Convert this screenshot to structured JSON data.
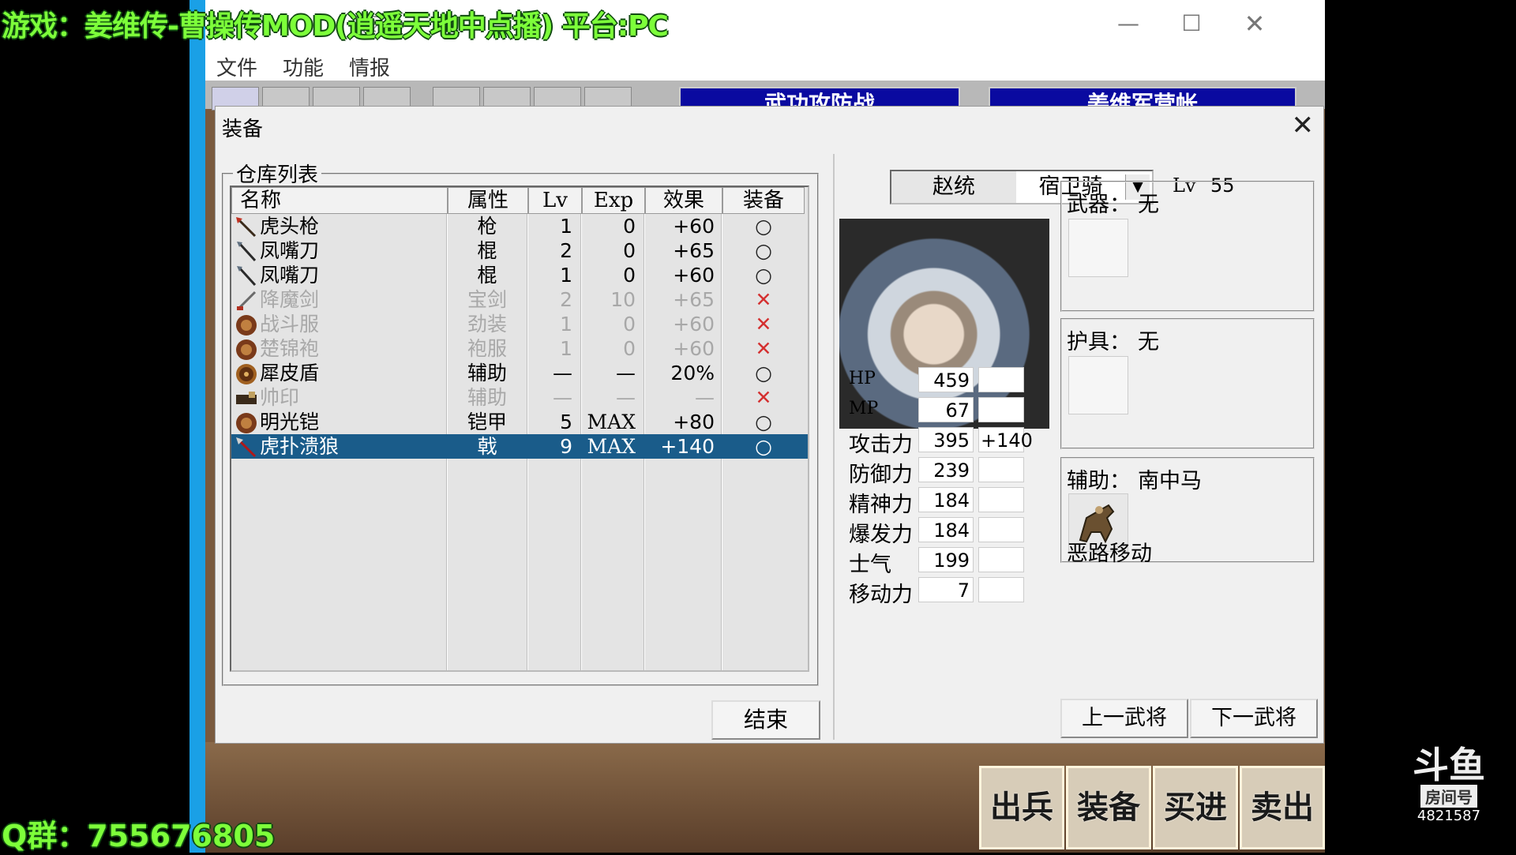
{
  "overlay": {
    "title": "游戏：姜维传-曹操传MOD(逍遥天地中点播)  平台:PC",
    "qq_group": "Q群：755676805",
    "logo_text": "斗鱼",
    "room_label": "房间号",
    "room_number": "4821587"
  },
  "window": {
    "title_fragment": "传",
    "minimize_icon": "—",
    "maximize_icon": "☐",
    "close_icon": "✕",
    "menus": [
      "文件",
      "功能",
      "情报"
    ],
    "toolbar_banners": [
      "武功攻防战",
      "姜维军营帐"
    ]
  },
  "game_buttons": [
    "出兵",
    "装备",
    "买进",
    "卖出"
  ],
  "dialog": {
    "title": "装备",
    "close_icon": "✕",
    "group_label": "仓库列表",
    "columns": [
      "名称",
      "属性",
      "Lv",
      "Exp",
      "效果",
      "装备"
    ],
    "items": [
      {
        "icon": "spear",
        "name": "虎头枪",
        "attr": "枪",
        "lv": "1",
        "exp": "0",
        "effect": "+60",
        "equip": "○",
        "ok": true
      },
      {
        "icon": "blade",
        "name": "凤嘴刀",
        "attr": "棍",
        "lv": "2",
        "exp": "0",
        "effect": "+65",
        "equip": "○",
        "ok": true
      },
      {
        "icon": "blade",
        "name": "凤嘴刀",
        "attr": "棍",
        "lv": "1",
        "exp": "0",
        "effect": "+60",
        "equip": "○",
        "ok": true
      },
      {
        "icon": "sword",
        "name": "降魔剑",
        "attr": "宝剑",
        "lv": "2",
        "exp": "10",
        "effect": "+65",
        "equip": "✕",
        "ok": false
      },
      {
        "icon": "armor",
        "name": "战斗服",
        "attr": "劲装",
        "lv": "1",
        "exp": "0",
        "effect": "+60",
        "equip": "✕",
        "ok": false
      },
      {
        "icon": "armor",
        "name": "楚锦袍",
        "attr": "袍服",
        "lv": "1",
        "exp": "0",
        "effect": "+60",
        "equip": "✕",
        "ok": false
      },
      {
        "icon": "shield",
        "name": "犀皮盾",
        "attr": "辅助",
        "lv": "—",
        "exp": "—",
        "effect": "20%",
        "equip": "○",
        "ok": true
      },
      {
        "icon": "seal",
        "name": "帅印",
        "attr": "辅助",
        "lv": "—",
        "exp": "—",
        "effect": "—",
        "equip": "✕",
        "ok": false
      },
      {
        "icon": "armor",
        "name": "明光铠",
        "attr": "铠甲",
        "lv": "5",
        "exp": "MAX",
        "effect": "+80",
        "equip": "○",
        "ok": true
      },
      {
        "icon": "halberd",
        "name": "虎扑溃狼",
        "attr": "戟",
        "lv": "9",
        "exp": "MAX",
        "effect": "+140",
        "equip": "○",
        "ok": true,
        "selected": true
      }
    ],
    "end_button": "结束",
    "general": {
      "name": "赵统",
      "class": "宿卫骑",
      "lv_label": "Lv",
      "lv": "55"
    },
    "stats": [
      {
        "label": "HP",
        "value": "459",
        "bonus": ""
      },
      {
        "label": "MP",
        "value": "67",
        "bonus": ""
      },
      {
        "label": "攻击力",
        "value": "395",
        "bonus": "+140"
      },
      {
        "label": "防御力",
        "value": "239",
        "bonus": ""
      },
      {
        "label": "精神力",
        "value": "184",
        "bonus": ""
      },
      {
        "label": "爆发力",
        "value": "184",
        "bonus": ""
      },
      {
        "label": "士气",
        "value": "199",
        "bonus": ""
      },
      {
        "label": "移动力",
        "value": "7",
        "bonus": ""
      }
    ],
    "slots": {
      "weapon": {
        "label": "武器：",
        "value": "无"
      },
      "armor": {
        "label": "护具：",
        "value": "无"
      },
      "aux": {
        "label": "辅助：",
        "value": "南中马",
        "ability": "恶路移动"
      }
    },
    "prev_button": "上一武将",
    "next_button": "下一武将",
    "colors": {
      "selected_row": "#1a5c8a",
      "disabled_text": "#a8a8a8",
      "cross": "#d43030"
    }
  }
}
